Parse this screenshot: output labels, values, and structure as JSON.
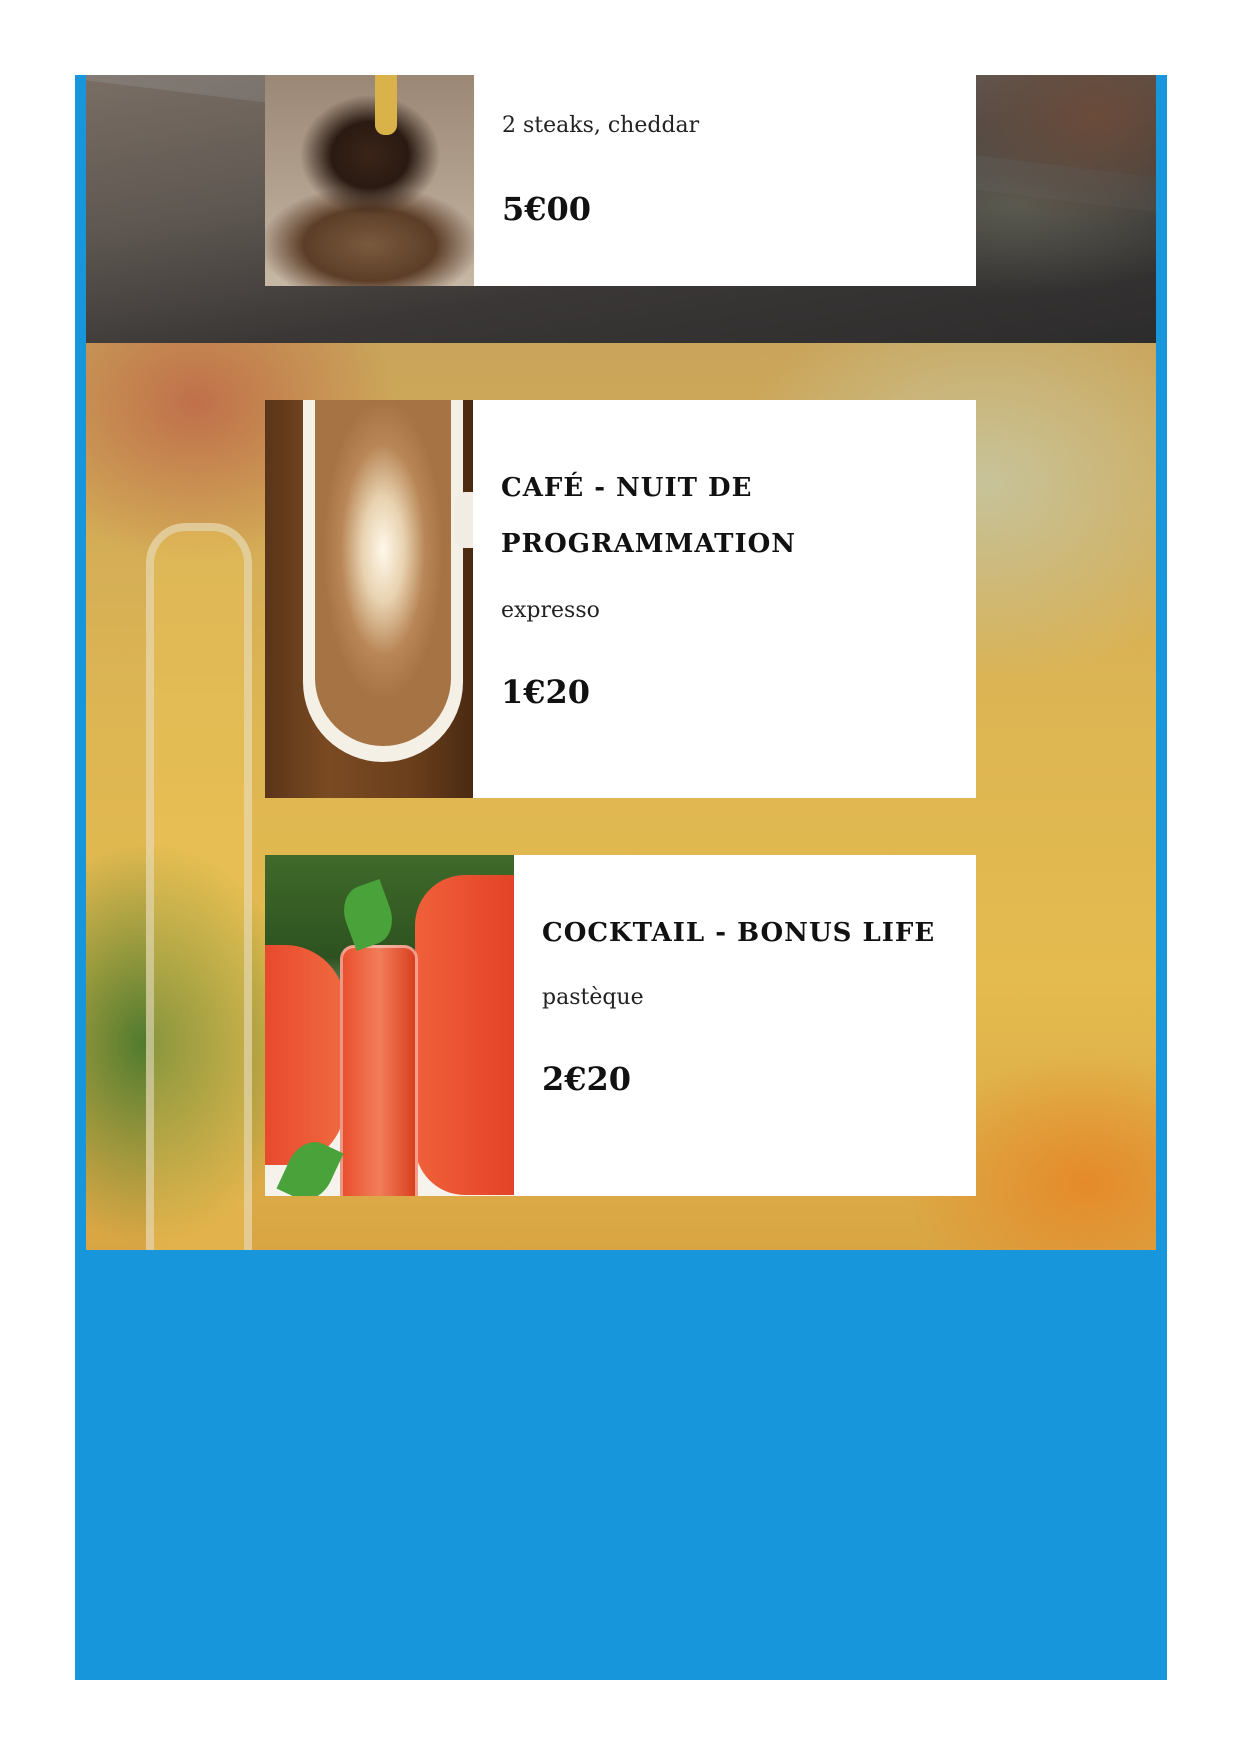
{
  "colors": {
    "frame_background": "#1796db",
    "card_background": "#ffffff",
    "text": "#111111"
  },
  "menu": {
    "items": [
      {
        "title": "",
        "description": "2 steaks, cheddar",
        "price": "5€00",
        "image": "burger-photo"
      },
      {
        "title": "CAFÉ - NUIT DE PROGRAMMATION",
        "description": "expresso",
        "price": "1€20",
        "image": "coffee-latte-art-photo"
      },
      {
        "title": "COCKTAIL - BONUS LIFE",
        "description": "pastèque",
        "price": "2€20",
        "image": "watermelon-cocktail-photo"
      }
    ]
  }
}
